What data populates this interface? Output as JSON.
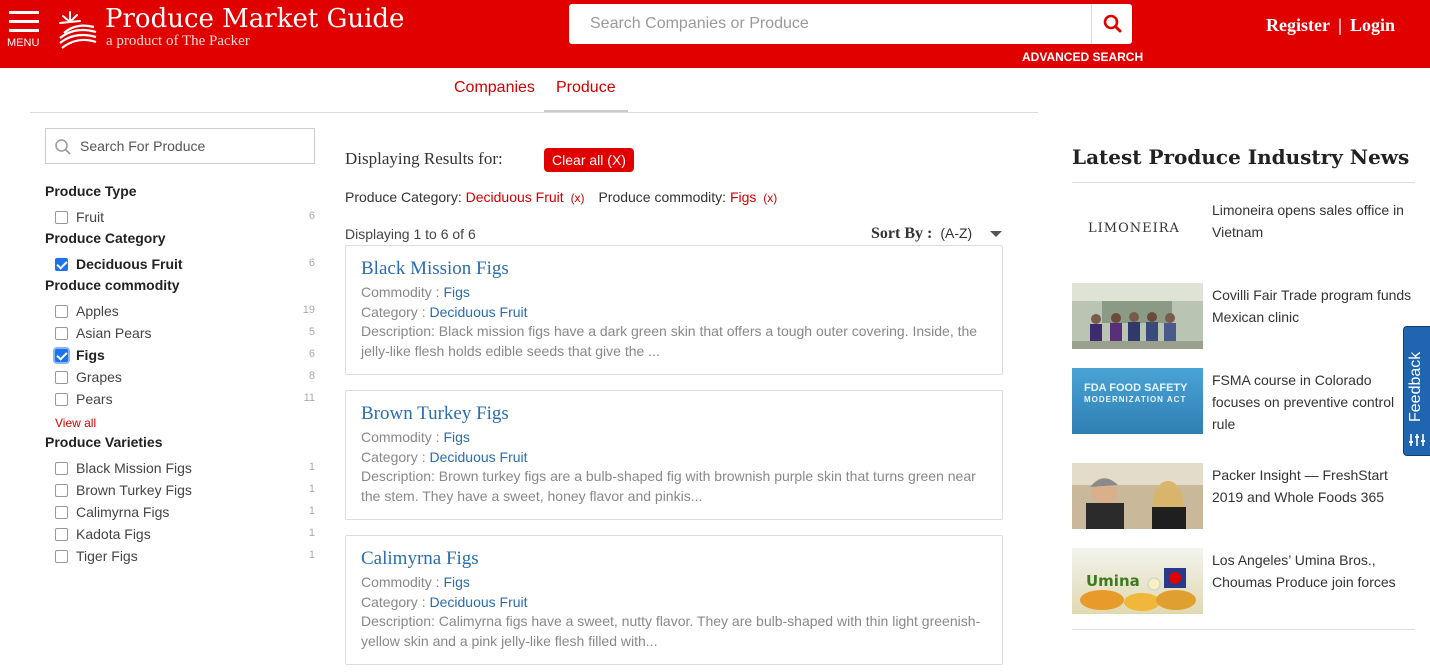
{
  "header": {
    "menu_label": "MENU",
    "brand_title": "Produce Market Guide",
    "brand_subtitle": "a product of The Packer",
    "search_placeholder": "Search Companies or Produce",
    "advanced_search": "ADVANCED SEARCH",
    "register": "Register",
    "separator": "|",
    "login": "Login",
    "accent_color": "#e00000"
  },
  "tabs": [
    {
      "label": "Companies",
      "active": false
    },
    {
      "label": "Produce",
      "active": true
    }
  ],
  "sidebar": {
    "search_placeholder": "Search For Produce",
    "view_all": "View all",
    "groups": [
      {
        "title": "Produce Type",
        "items": [
          {
            "label": "Fruit",
            "count": "6",
            "checked": false
          }
        ]
      },
      {
        "title": "Produce Category",
        "items": [
          {
            "label": "Deciduous Fruit",
            "count": "6",
            "checked": true
          }
        ]
      },
      {
        "title": "Produce commodity",
        "items": [
          {
            "label": "Apples",
            "count": "19",
            "checked": false
          },
          {
            "label": "Asian Pears",
            "count": "5",
            "checked": false
          },
          {
            "label": "Figs",
            "count": "6",
            "checked": true
          },
          {
            "label": "Grapes",
            "count": "8",
            "checked": false
          },
          {
            "label": "Pears",
            "count": "11",
            "checked": false
          }
        ]
      },
      {
        "title": "Produce Varieties",
        "items": [
          {
            "label": "Black Mission Figs",
            "count": "1",
            "checked": false
          },
          {
            "label": "Brown Turkey Figs",
            "count": "1",
            "checked": false
          },
          {
            "label": "Calimyrna Figs",
            "count": "1",
            "checked": false
          },
          {
            "label": "Kadota Figs",
            "count": "1",
            "checked": false
          },
          {
            "label": "Tiger Figs",
            "count": "1",
            "checked": false
          }
        ]
      }
    ]
  },
  "results": {
    "displaying_for": "Displaying Results for:",
    "clear_all": "Clear all (X)",
    "filter_category_label": "Produce Category:",
    "filter_category_value": "Deciduous Fruit",
    "filter_commodity_label": "Produce commodity:",
    "filter_commodity_value": "Figs",
    "remove_label": "(x)",
    "count_text": "Displaying 1 to 6 of 6",
    "sort_label": "Sort By :",
    "sort_value": "(A-Z)",
    "commodity_prefix": "Commodity :",
    "category_prefix": "Category :",
    "items": [
      {
        "title": "Black Mission Figs",
        "commodity": "Figs",
        "category": "Deciduous Fruit",
        "description": "Description: Black mission figs have a dark green skin that offers a tough outer covering. Inside, the jelly-like flesh holds edible seeds that give the ..."
      },
      {
        "title": "Brown Turkey Figs",
        "commodity": "Figs",
        "category": "Deciduous Fruit",
        "description": "Description: Brown turkey figs are a bulb-shaped fig with brownish purple skin that turns green near the stem. They have a sweet, honey flavor and pinkis..."
      },
      {
        "title": "Calimyrna Figs",
        "commodity": "Figs",
        "category": "Deciduous Fruit",
        "description": "Description: Calimyrna figs have a sweet, nutty flavor. They are bulb-shaped with thin light greenish-yellow skin and a pink jelly-like flesh filled with..."
      }
    ]
  },
  "news": {
    "heading": "Latest Produce Industry News",
    "items": [
      {
        "title": "Limoneira opens sales office in Vietnam",
        "thumb_text": "LIMONEIRA"
      },
      {
        "title": "Covilli Fair Trade program funds Mexican clinic"
      },
      {
        "title": "FSMA course in Colorado focuses on preventive control rule",
        "thumb_text": "FDA FOOD SAFETY",
        "thumb_text2": "MODERNIZATION ACT"
      },
      {
        "title": "Packer Insight — FreshStart 2019 and Whole Foods 365"
      },
      {
        "title": "Los Angeles’ Umina Bros., Choumas Produce join forces",
        "thumb_text": "Umina"
      }
    ]
  },
  "feedback_label": "Feedback"
}
